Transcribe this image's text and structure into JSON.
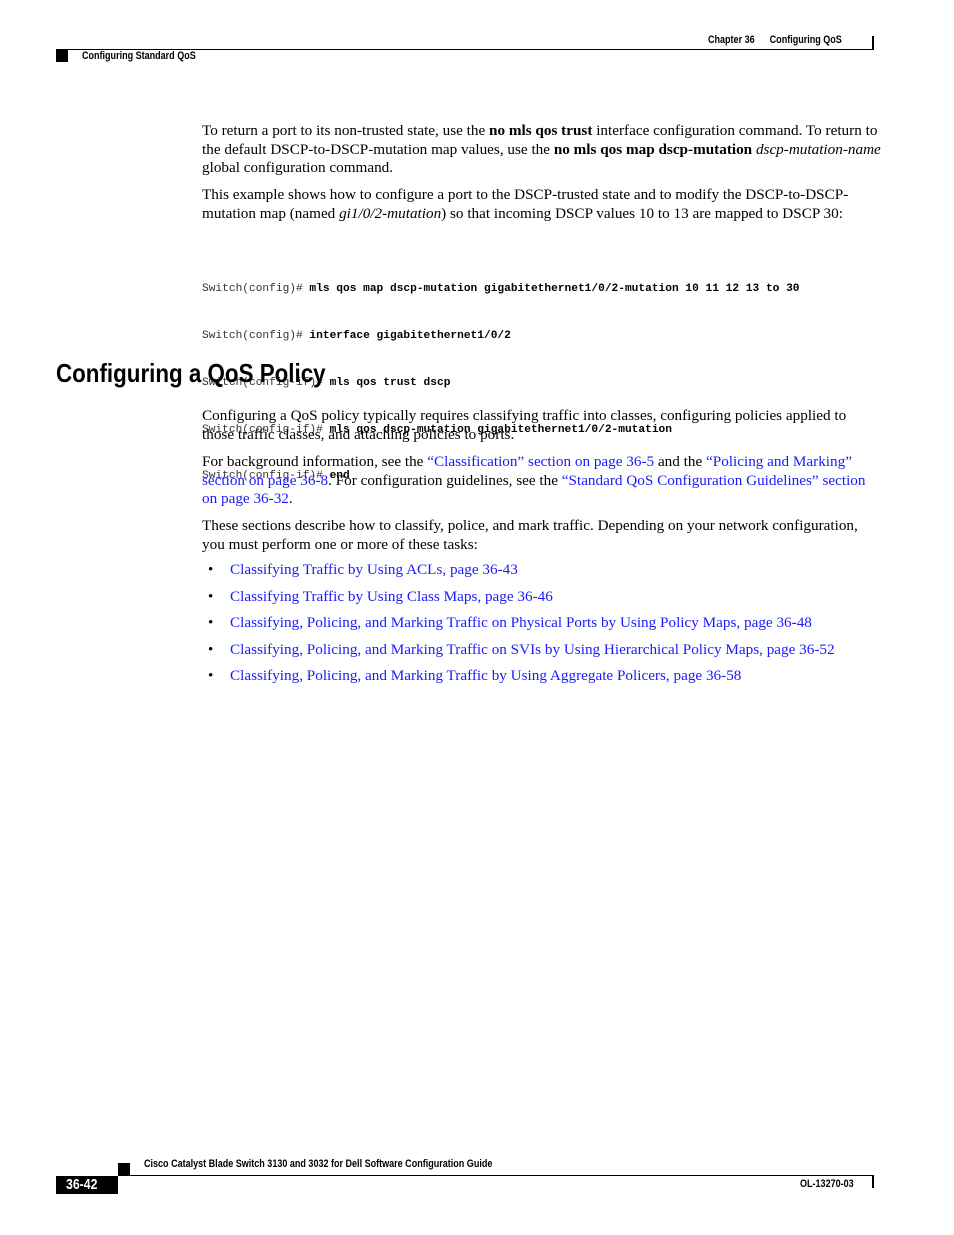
{
  "header": {
    "chapter": "Chapter 36",
    "chapter_title": "Configuring QoS",
    "section": "Configuring Standard QoS"
  },
  "intro": {
    "p1": {
      "t1": "To return a port to its non-trusted state, use the ",
      "b1": "no mls qos trust",
      "t2": " interface configuration command. To return to the default DSCP-to-DSCP-mutation map values, use the ",
      "b2": "no mls qos map dscp-mutation",
      "t3": " ",
      "i1": "dscp-mutation-name",
      "t4": " global configuration command."
    },
    "p2": {
      "t1": "This example shows how to configure a port to the DSCP-trusted state and to modify the DSCP-to-DSCP-mutation map (named ",
      "i1": "gi1/0/2-mutation",
      "t2": ") so that incoming DSCP values 10 to 13 are mapped to DSCP 30:"
    }
  },
  "code": [
    {
      "prompt": "Switch(config)# ",
      "cmd": "mls qos map dscp-mutation gigabitethernet1/0/2-mutation 10 11 12 13 to 30"
    },
    {
      "prompt": "Switch(config)# ",
      "cmd": "interface gigabitethernet1/0/2"
    },
    {
      "prompt": "Switch(config-if)# ",
      "cmd": "mls qos trust dscp"
    },
    {
      "prompt": "Switch(config-if)# ",
      "cmd": "mls qos dscp-mutation gigabitethernet1/0/2-mutation"
    },
    {
      "prompt": "Switch(config-if)# ",
      "cmd": "end"
    }
  ],
  "section": {
    "title": "Configuring a QoS Policy",
    "p1": "Configuring a QoS policy typically requires classifying traffic into classes, configuring policies applied to those traffic classes, and attaching policies to ports.",
    "p2": {
      "t1": "For background information, see the ",
      "link1": "“Classification” section on page 36-5",
      "t2": " and the ",
      "link2": "“Policing and Marking” section on page 36-8",
      "t3": ". For configuration guidelines, see the ",
      "link3": "“Standard QoS Configuration Guidelines” section on page 36-32",
      "t4": "."
    },
    "p3": "These sections describe how to classify, police, and mark traffic. Depending on your network configuration, you must perform one or more of these tasks:",
    "tasks": [
      "Classifying Traffic by Using ACLs, page 36-43",
      "Classifying Traffic by Using Class Maps, page 36-46",
      "Classifying, Policing, and Marking Traffic on Physical Ports by Using Policy Maps, page 36-48",
      "Classifying, Policing, and Marking Traffic on SVIs by Using Hierarchical Policy Maps, page 36-52",
      "Classifying, Policing, and Marking Traffic by Using Aggregate Policers, page 36-58"
    ],
    "bullet": "•"
  },
  "footer": {
    "guide_title": "Cisco Catalyst Blade Switch 3130 and 3032 for Dell Software Configuration Guide",
    "page_number": "36-42",
    "doc_id": "OL-13270-03"
  },
  "colors": {
    "link": "#1a1aff",
    "text": "#000000"
  }
}
